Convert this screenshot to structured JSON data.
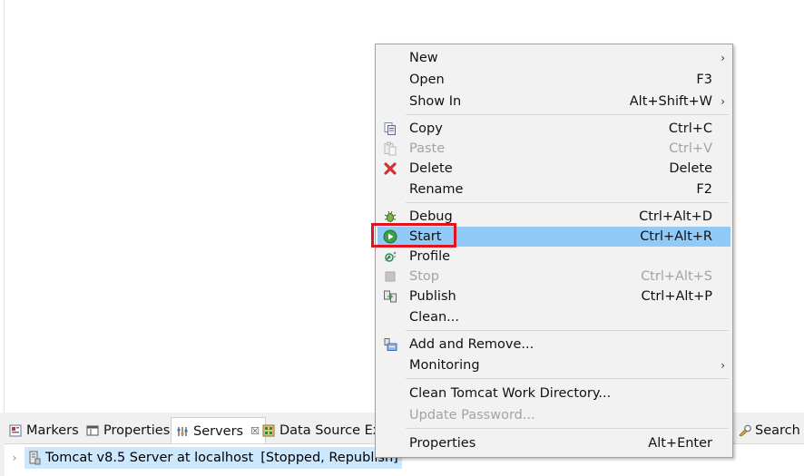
{
  "tabs": {
    "markers": "Markers",
    "properties": "Properties",
    "servers": "Servers",
    "servers_close": "☒",
    "data_source": "Data Source Ex",
    "search": "Search"
  },
  "server": {
    "name": "Tomcat v8.5 Server at localhost",
    "status": "[Stopped, Republish]"
  },
  "menu": {
    "new": {
      "label": "New",
      "arrow": "›"
    },
    "open": {
      "label": "Open",
      "shortcut": "F3"
    },
    "show_in": {
      "label": "Show In",
      "shortcut": "Alt+Shift+W",
      "arrow": "›"
    },
    "copy": {
      "label": "Copy",
      "shortcut": "Ctrl+C"
    },
    "paste": {
      "label": "Paste",
      "shortcut": "Ctrl+V"
    },
    "delete": {
      "label": "Delete",
      "shortcut": "Delete"
    },
    "rename": {
      "label": "Rename",
      "shortcut": "F2"
    },
    "debug": {
      "label": "Debug",
      "shortcut": "Ctrl+Alt+D"
    },
    "start": {
      "label": "Start",
      "shortcut": "Ctrl+Alt+R"
    },
    "profile": {
      "label": "Profile"
    },
    "stop": {
      "label": "Stop",
      "shortcut": "Ctrl+Alt+S"
    },
    "publish": {
      "label": "Publish",
      "shortcut": "Ctrl+Alt+P"
    },
    "clean": {
      "label": "Clean..."
    },
    "add_remove": {
      "label": "Add and Remove..."
    },
    "monitoring": {
      "label": "Monitoring",
      "arrow": "›"
    },
    "clean_work": {
      "label": "Clean Tomcat Work Directory..."
    },
    "update_password": {
      "label": "Update Password..."
    },
    "properties": {
      "label": "Properties",
      "shortcut": "Alt+Enter"
    }
  },
  "colors": {
    "menu_bg": "#f2f2f2",
    "menu_highlight": "#91c9f7",
    "annotation_red": "#e3121c",
    "selection_bg": "#cce8ff",
    "disabled_text": "#a3a3a3"
  }
}
